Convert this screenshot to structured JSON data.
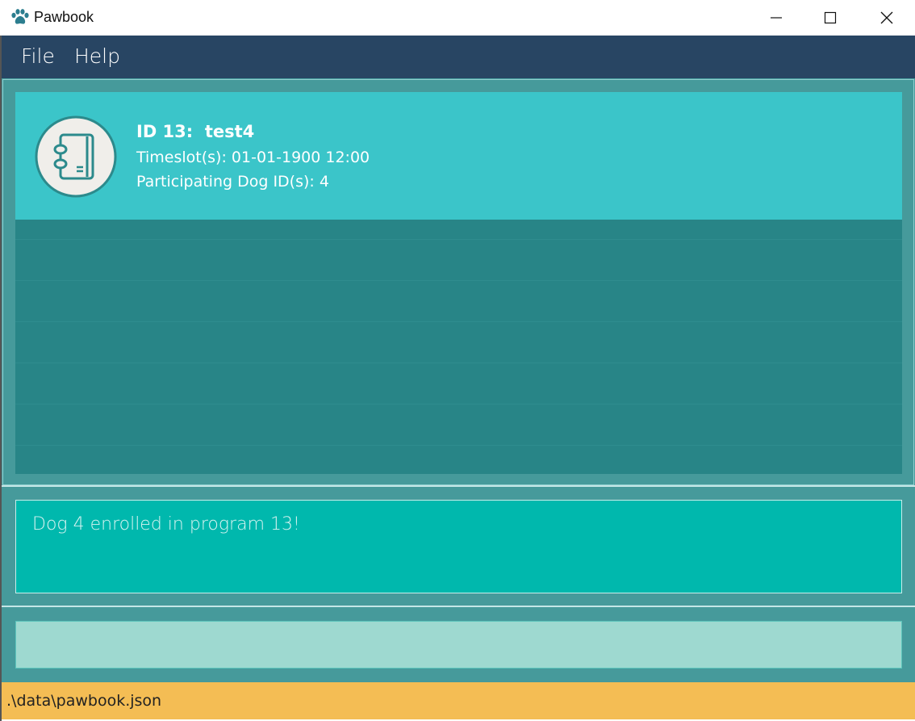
{
  "window": {
    "title": "Pawbook",
    "minimize_icon": "minimize-icon",
    "maximize_icon": "maximize-icon",
    "close_icon": "close-icon"
  },
  "menu": {
    "items": [
      {
        "label": "File"
      },
      {
        "label": "Help"
      }
    ]
  },
  "program_list": {
    "items": [
      {
        "id_label": "ID 13:",
        "name": "test4",
        "timeslot": "Timeslot(s): 01-01-1900 12:00",
        "dogs": "Participating Dog ID(s): 4",
        "icon": "notebook-icon"
      }
    ]
  },
  "result": {
    "message": "Dog 4 enrolled in program 13!"
  },
  "command": {
    "value": ""
  },
  "status": {
    "file_path": ".\\data\\pawbook.json"
  },
  "colors": {
    "menubar": "#284563",
    "card": "#3bc5c9",
    "list_bg": "#288587",
    "result_bg": "#00b8ad",
    "command_bg": "#9ed9d0",
    "statusbar": "#f4bd54"
  }
}
